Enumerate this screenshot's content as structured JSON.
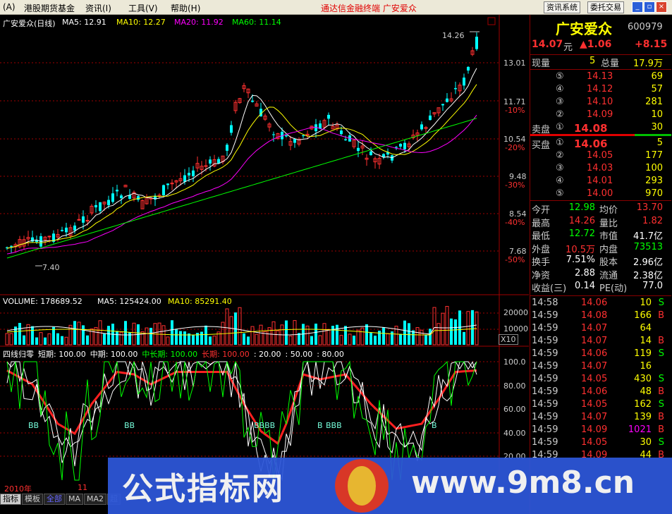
{
  "menubar": {
    "items": [
      "(A)",
      "港股期货基金",
      "资讯(I)",
      "工具(V)",
      "帮助(H)"
    ],
    "title": "通达信金融终端    广安爱众",
    "buttons": [
      "资讯系统",
      "委托交易"
    ],
    "window_icons": [
      "minimize-icon",
      "restore-icon",
      "close-icon"
    ]
  },
  "chart": {
    "stock_label": "广安爱众(日线)",
    "ma_header": [
      {
        "label": "MA5: 12.91",
        "color": "#ffffff"
      },
      {
        "label": "MA10: 12.27",
        "color": "#ffff00"
      },
      {
        "label": "MA20: 11.92",
        "color": "#ff00ff"
      },
      {
        "label": "MA60: 11.14",
        "color": "#00ff00"
      }
    ],
    "price_axis": [
      {
        "price": "13.01",
        "pct": ""
      },
      {
        "price": "11.71",
        "pct": "-10%"
      },
      {
        "price": "10.54",
        "pct": "-20%"
      },
      {
        "price": "9.48",
        "pct": "-30%"
      },
      {
        "price": "8.54",
        "pct": "-40%"
      },
      {
        "price": "7.68",
        "pct": "-50%"
      }
    ],
    "high_note": "14.26",
    "low_note": "7.40",
    "volume_header": [
      {
        "label": "VOLUME: 178689.52",
        "color": "#ffffff"
      },
      {
        "label": "MA5: 125424.00",
        "color": "#ffffff"
      },
      {
        "label": "MA10: 85291.40",
        "color": "#ffff00"
      }
    ],
    "volume_axis": [
      "20000",
      "10000",
      "X10"
    ],
    "indicator_header": [
      {
        "label": "四线归零",
        "color": "#ffffff"
      },
      {
        "label": "短期: 100.00",
        "color": "#ffffff"
      },
      {
        "label": "中期: 100.00",
        "color": "#ffffff"
      },
      {
        "label": "中长期: 100.00",
        "color": "#00ff00"
      },
      {
        "label": "长期: 100.00",
        "color": "#ff3030"
      },
      {
        "label": ": 20.00",
        "color": "#ffffff"
      },
      {
        "label": ": 50.00",
        "color": "#ffffff"
      },
      {
        "label": ": 80.00",
        "color": "#ffffff"
      }
    ],
    "indicator_axis": [
      "100.0",
      "80.00",
      "60.00",
      "40.00",
      "20.00"
    ],
    "b_marks": [
      "BB",
      "BB",
      "BBBB",
      "B",
      "BBB",
      "B"
    ],
    "date_labels": [
      "2010年",
      "11"
    ]
  },
  "tabs": [
    "指标",
    "模板",
    "全部",
    "MA",
    "MA2",
    "超"
  ],
  "quote": {
    "name": "广安爱众",
    "code": "600979",
    "price": "14.07",
    "price_unit": "元",
    "change": "▲1.06",
    "change_pct": "+8.15",
    "now_vol_label": "现量",
    "now_vol": "5",
    "total_vol_label": "总量",
    "total_vol": "17.9万",
    "asks": [
      {
        "level": "⑤",
        "price": "14.13",
        "vol": "69"
      },
      {
        "level": "④",
        "price": "14.12",
        "vol": "57"
      },
      {
        "level": "③",
        "price": "14.10",
        "vol": "281"
      },
      {
        "level": "②",
        "price": "14.09",
        "vol": "10"
      },
      {
        "level": "①",
        "price": "14.08",
        "vol": "30",
        "label": "卖盘"
      }
    ],
    "bids": [
      {
        "level": "①",
        "price": "14.06",
        "vol": "5",
        "label": "买盘"
      },
      {
        "level": "②",
        "price": "14.05",
        "vol": "177"
      },
      {
        "level": "③",
        "price": "14.03",
        "vol": "100"
      },
      {
        "level": "④",
        "price": "14.01",
        "vol": "293"
      },
      {
        "level": "⑤",
        "price": "14.00",
        "vol": "970"
      }
    ],
    "stats": [
      {
        "l1": "今开",
        "v1": "12.98",
        "c1": "#00ff00",
        "l2": "均价",
        "v2": "13.70",
        "c2": "#ff3030"
      },
      {
        "l1": "最高",
        "v1": "14.26",
        "c1": "#ff3030",
        "l2": "量比",
        "v2": "1.82",
        "c2": "#ff3030"
      },
      {
        "l1": "最低",
        "v1": "12.72",
        "c1": "#00ff00",
        "l2": "市值",
        "v2": "41.7亿",
        "c2": "#ffffff"
      },
      {
        "l1": "外盘",
        "v1": "10.5万",
        "c1": "#ff3030",
        "l2": "内盘",
        "v2": "73513",
        "c2": "#00ff00"
      },
      {
        "l1": "换手",
        "v1": "7.51%",
        "c1": "#ffffff",
        "l2": "股本",
        "v2": "2.96亿",
        "c2": "#ffffff"
      },
      {
        "l1": "净资",
        "v1": "2.88",
        "c1": "#ffffff",
        "l2": "流通",
        "v2": "2.38亿",
        "c2": "#ffffff"
      },
      {
        "l1": "收益(三)",
        "v1": "0.14",
        "c1": "#ffffff",
        "l2": "PE(动)",
        "v2": "77.0",
        "c2": "#ffffff"
      }
    ],
    "ticks": [
      {
        "time": "14:58",
        "price": "14.06",
        "vol": "10",
        "side": "S"
      },
      {
        "time": "14:59",
        "price": "14.08",
        "vol": "166",
        "side": "B"
      },
      {
        "time": "14:59",
        "price": "14.07",
        "vol": "64",
        "side": ""
      },
      {
        "time": "14:59",
        "price": "14.07",
        "vol": "14",
        "side": "B"
      },
      {
        "time": "14:59",
        "price": "14.06",
        "vol": "119",
        "side": "S"
      },
      {
        "time": "14:59",
        "price": "14.07",
        "vol": "16",
        "side": ""
      },
      {
        "time": "14:59",
        "price": "14.05",
        "vol": "430",
        "side": "S"
      },
      {
        "time": "14:59",
        "price": "14.06",
        "vol": "48",
        "side": "B"
      },
      {
        "time": "14:59",
        "price": "14.05",
        "vol": "162",
        "side": "S"
      },
      {
        "time": "14:59",
        "price": "14.07",
        "vol": "139",
        "side": "B"
      },
      {
        "time": "14:59",
        "price": "14.09",
        "vol": "1021",
        "side": "B"
      },
      {
        "time": "14:59",
        "price": "14.05",
        "vol": "30",
        "side": "S"
      },
      {
        "time": "14:59",
        "price": "14.09",
        "vol": "44",
        "side": "B"
      }
    ]
  },
  "watermark": {
    "left_text": "公式指标网",
    "right_text": "www.9m8.cn"
  }
}
